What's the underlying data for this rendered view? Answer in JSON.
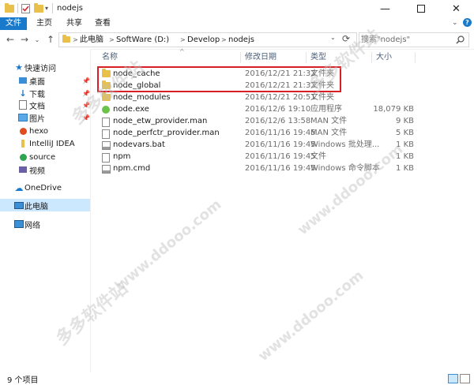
{
  "window": {
    "title": "nodejs",
    "controls": [
      "minimize",
      "maximize",
      "close"
    ]
  },
  "ribbon": {
    "tabs": [
      "文件",
      "主页",
      "共享",
      "查看"
    ]
  },
  "address": {
    "breadcrumbs": [
      "此电脑",
      "SoftWare (D:)",
      "Develop",
      "nodejs"
    ],
    "search_placeholder": "搜索\"nodejs\""
  },
  "nav": {
    "items": [
      {
        "label": "快速访问",
        "icon": "star-icon",
        "pinned": false
      },
      {
        "label": "桌面",
        "icon": "desktop-icon",
        "pinned": true
      },
      {
        "label": "下载",
        "icon": "download-icon",
        "pinned": true
      },
      {
        "label": "文档",
        "icon": "document-icon",
        "pinned": true
      },
      {
        "label": "图片",
        "icon": "picture-icon",
        "pinned": true
      },
      {
        "label": "hexo",
        "icon": "hexo-icon",
        "pinned": false
      },
      {
        "label": "IntelliJ IDEA",
        "icon": "folder-icon",
        "pinned": false
      },
      {
        "label": "source",
        "icon": "source-icon",
        "pinned": false
      },
      {
        "label": "视频",
        "icon": "video-icon",
        "pinned": false
      },
      {
        "label": "OneDrive",
        "icon": "cloud-icon",
        "pinned": false
      },
      {
        "label": "此电脑",
        "icon": "computer-icon",
        "pinned": false
      },
      {
        "label": "网络",
        "icon": "network-icon",
        "pinned": false
      }
    ]
  },
  "columns": [
    "名称",
    "修改日期",
    "类型",
    "大小"
  ],
  "files": [
    {
      "name": "node_cache",
      "date": "2016/12/21 21:32",
      "type": "文件夹",
      "size": "",
      "icon": "folder-icon"
    },
    {
      "name": "node_global",
      "date": "2016/12/21 21:32",
      "type": "文件夹",
      "size": "",
      "icon": "folder-icon"
    },
    {
      "name": "node_modules",
      "date": "2016/12/21 20:51",
      "type": "文件夹",
      "size": "",
      "icon": "folder-icon"
    },
    {
      "name": "node.exe",
      "date": "2016/12/6 19:10",
      "type": "应用程序",
      "size": "18,079 KB",
      "icon": "nodejs-icon"
    },
    {
      "name": "node_etw_provider.man",
      "date": "2016/12/6 13:58",
      "type": "MAN 文件",
      "size": "9 KB",
      "icon": "file-icon"
    },
    {
      "name": "node_perfctr_provider.man",
      "date": "2016/11/16 19:45",
      "type": "MAN 文件",
      "size": "5 KB",
      "icon": "file-icon"
    },
    {
      "name": "nodevars.bat",
      "date": "2016/11/16 19:45",
      "type": "Windows 批处理...",
      "size": "1 KB",
      "icon": "bat-icon"
    },
    {
      "name": "npm",
      "date": "2016/11/16 19:45",
      "type": "文件",
      "size": "1 KB",
      "icon": "file-icon"
    },
    {
      "name": "npm.cmd",
      "date": "2016/11/16 19:45",
      "type": "Windows 命令脚本",
      "size": "1 KB",
      "icon": "bat-icon"
    }
  ],
  "status": {
    "item_count": "9 个项目"
  },
  "watermark": {
    "text": "多多软件站",
    "url": "www.ddooo.com"
  },
  "colors": {
    "accent": "#1979ca",
    "selected_nav": "#cce8ff",
    "folder": "#e8c04a",
    "highlight_box": "#d81f26"
  }
}
